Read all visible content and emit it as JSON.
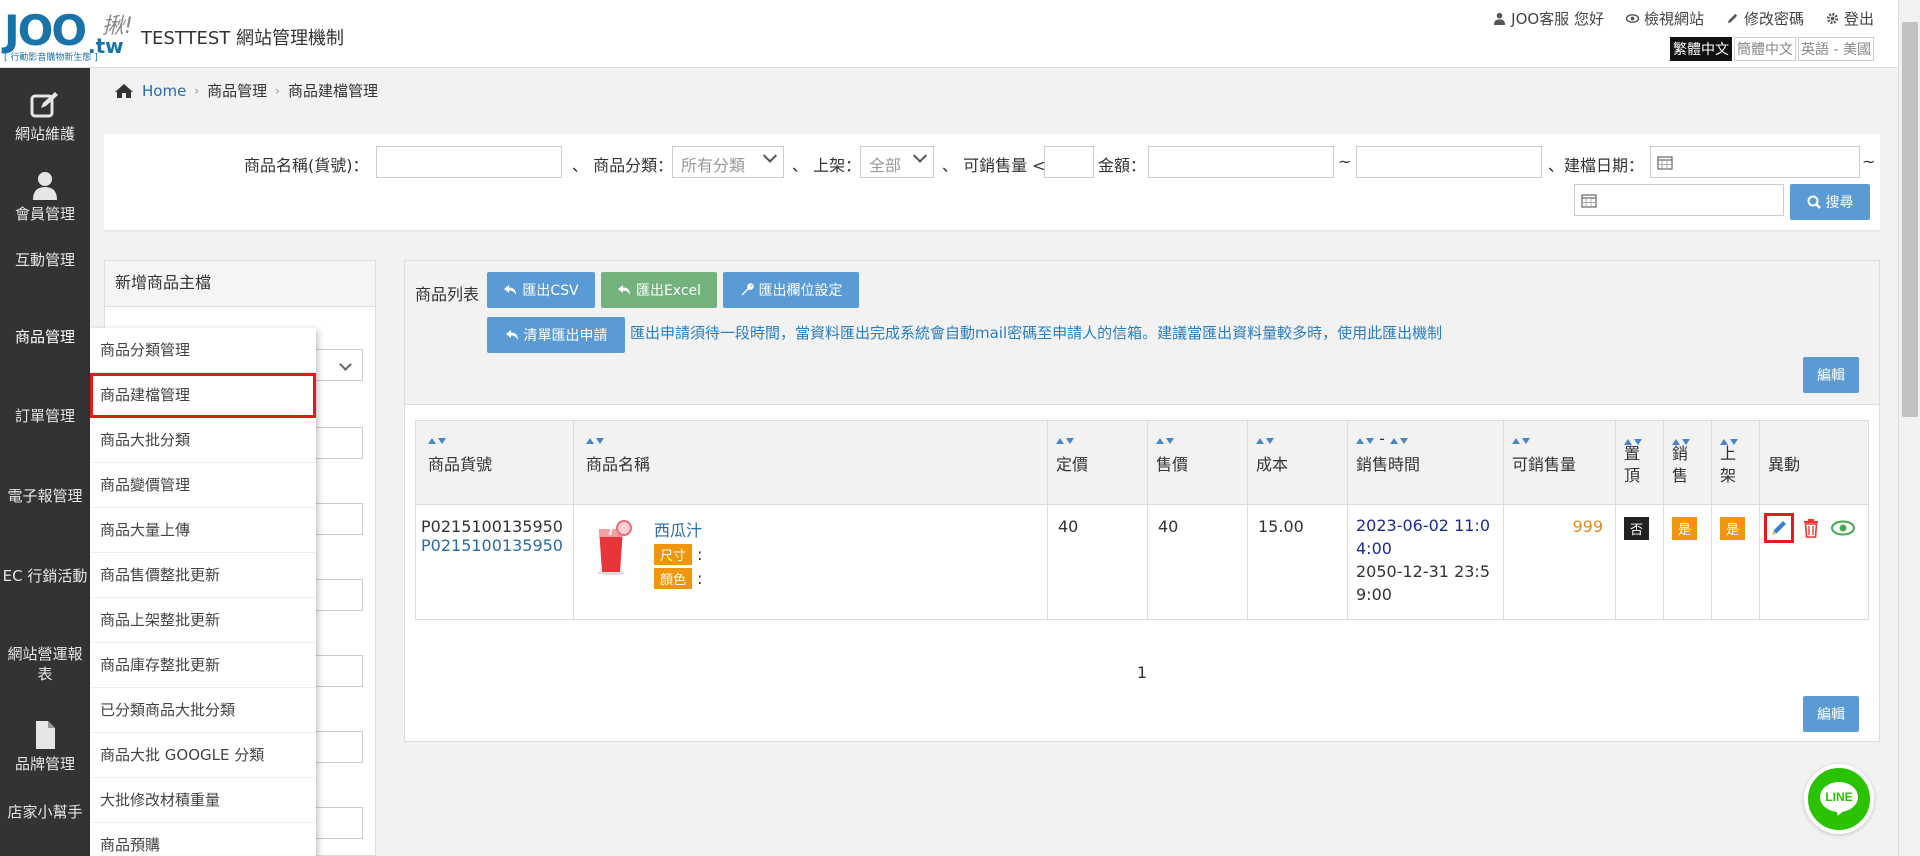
{
  "header": {
    "logo_text": "JOO",
    "logo_tw": ".tw",
    "logo_jiu": "揪!",
    "logo_slogan": "[ 行動影音購物新生態 ]",
    "site_title": "TESTTEST 網站管理機制",
    "links": {
      "customer": "JOO客服 您好",
      "view_site": "檢視網站",
      "change_password": "修改密碼",
      "logout": "登出"
    },
    "languages": [
      "繁體中文",
      "簡體中文",
      "英語 - 美國"
    ]
  },
  "leftnav": {
    "items": [
      "網站維護",
      "會員管理",
      "互動管理",
      "商品管理",
      "訂單管理",
      "電子報管理",
      "EC 行銷活動",
      "網站營運報表",
      "品牌管理",
      "店家小幫手"
    ]
  },
  "submenu": {
    "items": [
      "商品分類管理",
      "商品建檔管理",
      "商品大批分類",
      "商品變價管理",
      "商品大量上傳",
      "商品售價整批更新",
      "商品上架整批更新",
      "商品庫存整批更新",
      "已分類商品大批分類",
      "商品大批 GOOGLE 分類",
      "大批修改材積重量",
      "商品預購"
    ]
  },
  "breadcrumb": {
    "home": "Home",
    "level1": "商品管理",
    "level2": "商品建檔管理"
  },
  "filter": {
    "name_label": "商品名稱(貨號)：",
    "category_label": "、 商品分類：",
    "category_value": "所有分類",
    "onshelf_label": "、 上架：",
    "onshelf_value": "全部",
    "stock_label": "、 可銷售量 <",
    "amount_label": "金額：",
    "tilde": "~",
    "date_label": "、建檔日期：",
    "search_button": "搜尋"
  },
  "leftpanel": {
    "title": "新增商品主檔"
  },
  "productlist": {
    "title": "商品列表",
    "export_csv": "匯出CSV",
    "export_excel": "匯出Excel",
    "export_fields": "匯出欄位設定",
    "clear_export": "清單匯出申請",
    "note": "匯出申請須待一段時間，當資料匯出完成系統會自動mail密碼至申請人的信箱。建議當匯出資料量較多時，使用此匯出機制",
    "edit_button": "編輯",
    "columns": {
      "sku": "商品貨號",
      "name": "商品名稱",
      "price": "定價",
      "sale_price": "售價",
      "cost": "成本",
      "sale_time": "銷售時間",
      "stock": "可銷售量",
      "pin1": "置",
      "pin2": "頂",
      "hot1": "銷",
      "hot2": "售",
      "shelf1": "上",
      "shelf2": "架",
      "action": "異動"
    },
    "rows": [
      {
        "sku": "P0215100135950",
        "sku_link": "P0215100135950",
        "name": "西瓜汁",
        "tag_size": "尺寸",
        "tag_color": "顏色",
        "colon": ":",
        "price": "40",
        "sale_price": "40",
        "cost": "15.00",
        "sale_start_1": "2023-06-02 11:0",
        "sale_start_2": "4:00",
        "sale_end_1": "2050-12-31 23:5",
        "sale_end_2": "9:00",
        "stock": "999",
        "pinned": "否",
        "selling": "是",
        "onshelf": "是"
      }
    ],
    "page": "1"
  },
  "line_button": "LINE",
  "colors": {
    "primary_blue": "#5b9bd5",
    "green": "#73b17d",
    "nav_bg": "#333333",
    "highlight_red": "#e01b1b",
    "tag_orange": "#f0960e"
  }
}
